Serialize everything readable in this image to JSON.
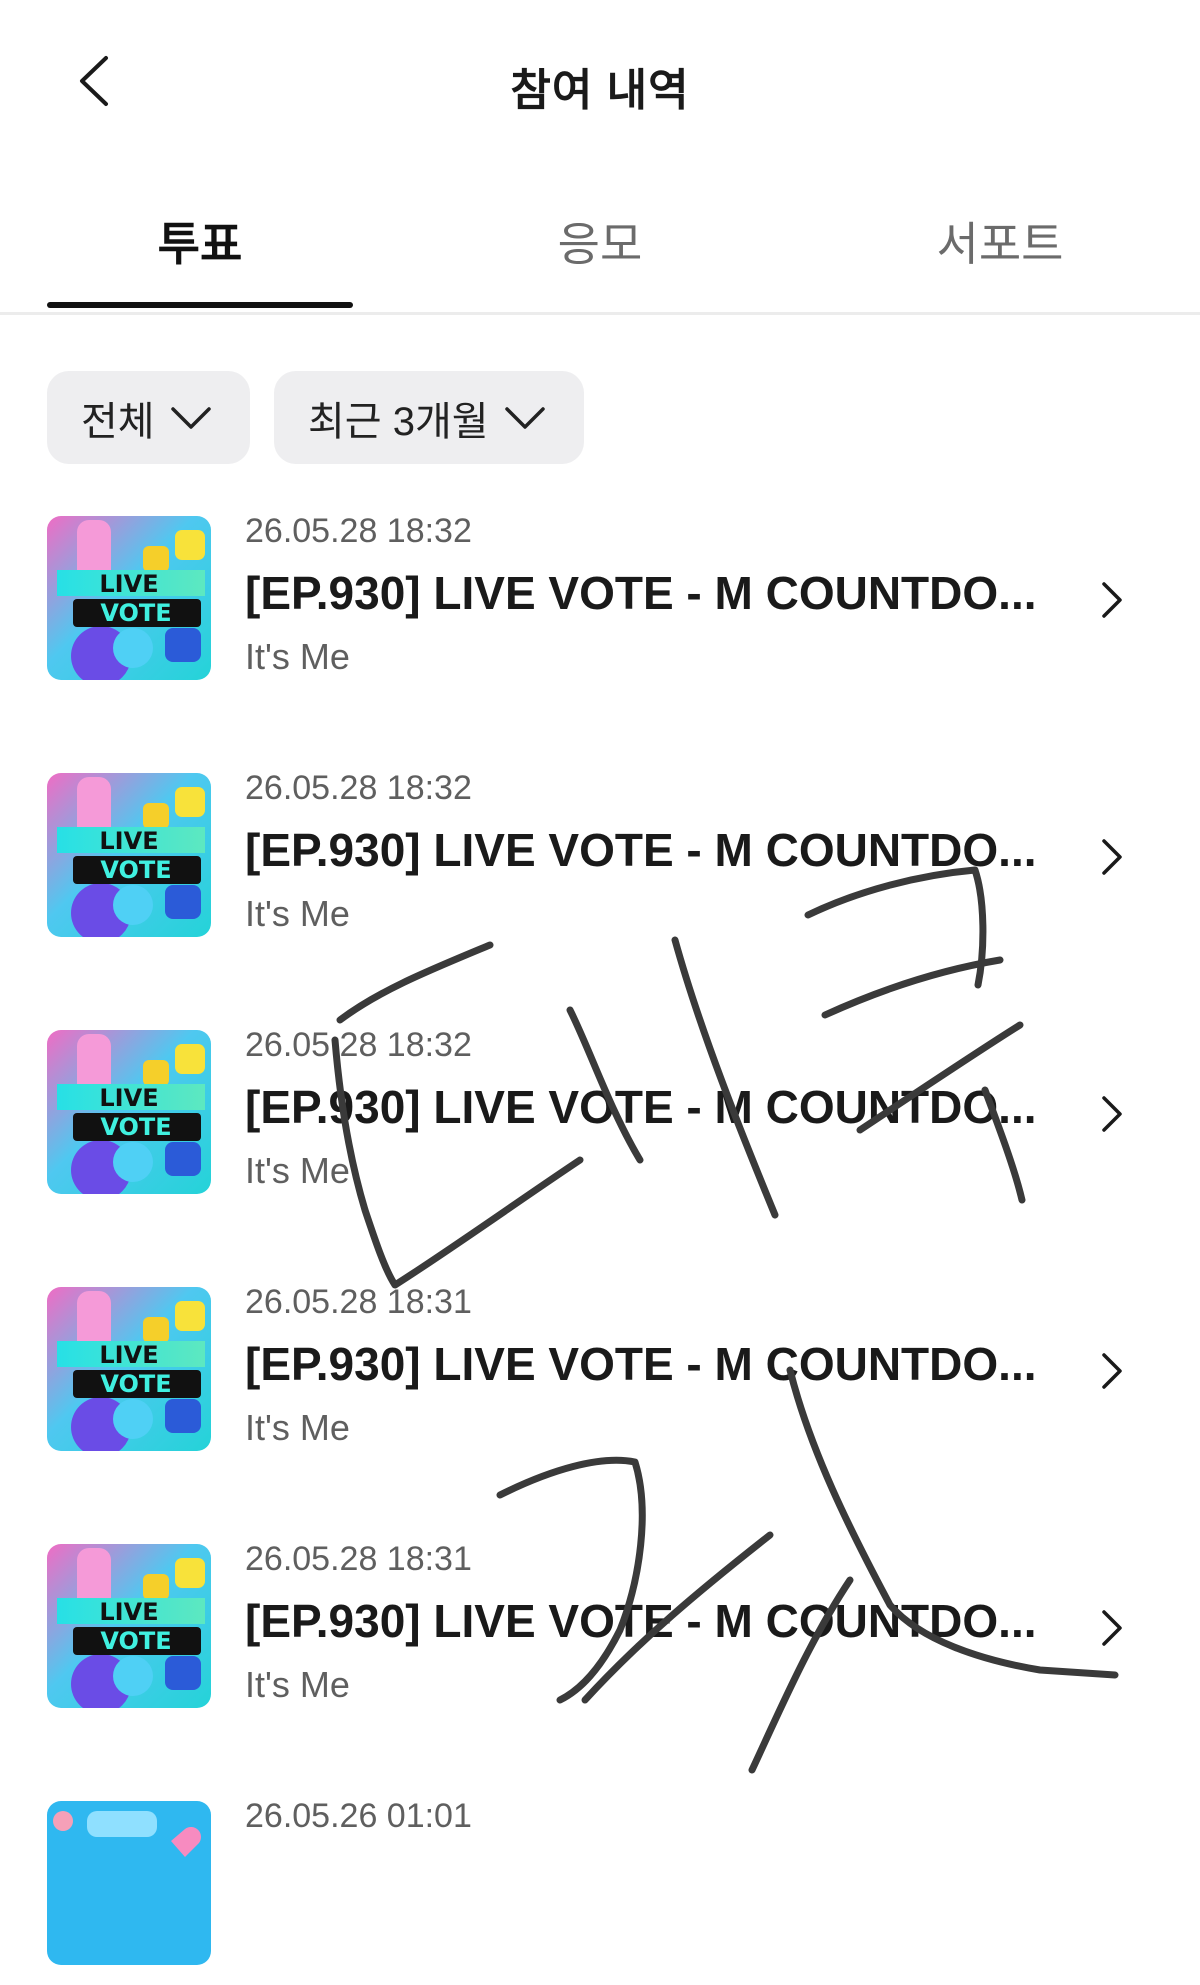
{
  "header": {
    "title": "참여 내역",
    "back_icon": "chevron-left-icon"
  },
  "tabs": [
    {
      "label": "투표",
      "active": true
    },
    {
      "label": "응모",
      "active": false
    },
    {
      "label": "서포트",
      "active": false
    }
  ],
  "filters": {
    "type": {
      "label": "전체",
      "icon": "chevron-down-icon"
    },
    "period": {
      "label": "최근 3개월",
      "icon": "chevron-down-icon"
    }
  },
  "thumbnail": {
    "line1": "LIVE",
    "line2": "VOTE"
  },
  "votes": [
    {
      "date": "26.05.28 18:32",
      "title": "[EP.930] LIVE VOTE - M COUNTDO...",
      "subtitle": "It's Me"
    },
    {
      "date": "26.05.28 18:32",
      "title": "[EP.930] LIVE VOTE - M COUNTDO...",
      "subtitle": "It's Me"
    },
    {
      "date": "26.05.28 18:32",
      "title": "[EP.930] LIVE VOTE - M COUNTDO...",
      "subtitle": "It's Me"
    },
    {
      "date": "26.05.28 18:31",
      "title": "[EP.930] LIVE VOTE - M COUNTDO...",
      "subtitle": "It's Me"
    },
    {
      "date": "26.05.28 18:31",
      "title": "[EP.930] LIVE VOTE - M COUNTDO...",
      "subtitle": "It's Me"
    },
    {
      "date": "26.05.26 01:01",
      "title": "",
      "subtitle": ""
    }
  ],
  "colors": {
    "accent": "#111111",
    "chip_bg": "#eeeef0",
    "muted_text": "#5f5f5f",
    "thumb_blue": "#2cc6ee",
    "thumb_pink": "#f07ac8",
    "thumb_yellow": "#f8e23a",
    "thumb_purple": "#6a4ce6",
    "scribble": "#3a3a3a"
  }
}
